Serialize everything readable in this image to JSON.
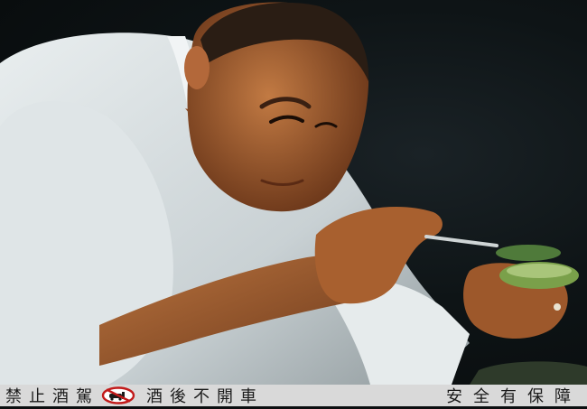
{
  "warning_bar": {
    "part_1": "禁止酒駕",
    "icon": "no-drinking-driving-icon",
    "part_2": "酒後不開車",
    "part_3": "安全有保障"
  },
  "photo": {
    "subject": "chef-plating-food-icon"
  }
}
